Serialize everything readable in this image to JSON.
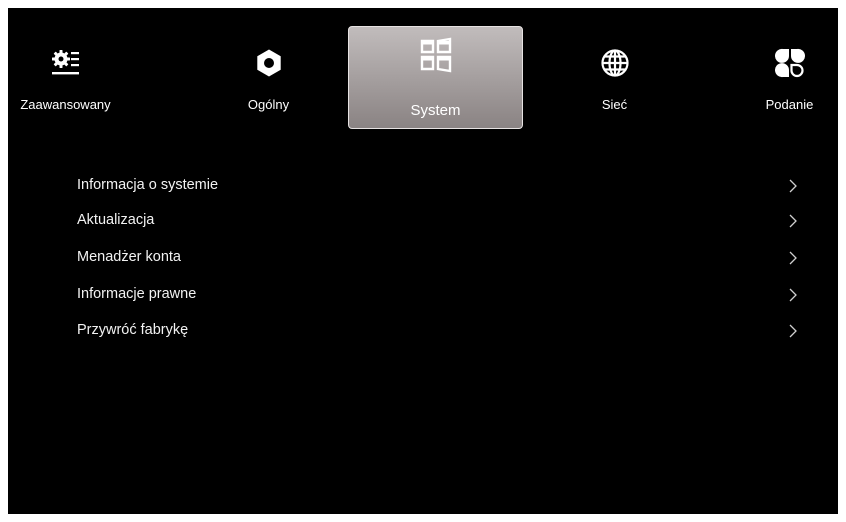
{
  "tabs": [
    {
      "id": "advanced",
      "label": "Zaawansowany",
      "icon": "advanced-settings-icon",
      "selected": false
    },
    {
      "id": "general",
      "label": "Ogólny",
      "icon": "gear-icon",
      "selected": false
    },
    {
      "id": "system",
      "label": "System",
      "icon": "windows-icon",
      "selected": true
    },
    {
      "id": "network",
      "label": "Sieć",
      "icon": "globe-icon",
      "selected": false
    },
    {
      "id": "input",
      "label": "Podanie",
      "icon": "input-source-icon",
      "selected": false
    }
  ],
  "menu": {
    "items": [
      {
        "label": "Informacja o systemie"
      },
      {
        "label": "Aktualizacja"
      },
      {
        "label": "Menadżer konta"
      },
      {
        "label": "Informacje prawne"
      },
      {
        "label": "Przywróć fabrykę"
      }
    ]
  },
  "colors": {
    "background": "#000000",
    "text": "#ffffff",
    "selected_tab": "#a8a2a2"
  }
}
